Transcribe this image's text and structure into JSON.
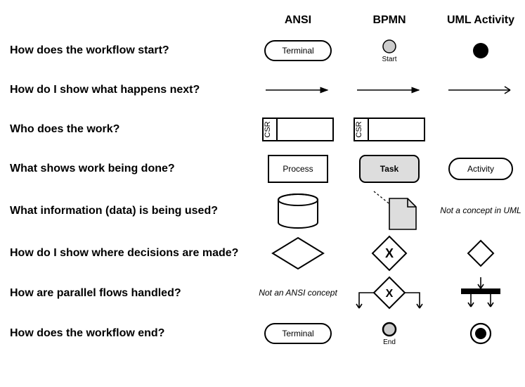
{
  "headers": {
    "ansi": "ANSI",
    "bpmn": "BPMN",
    "uml": "UML Activity"
  },
  "questions": {
    "q1": "How does the workflow start?",
    "q2": "How do I show what happens next?",
    "q3": "Who does the work?",
    "q4": "What shows work being done?",
    "q5": "What information (data) is being used?",
    "q6": "How do I show where decisions are made?",
    "q7": "How are parallel flows handled?",
    "q8": "How does the workflow end?"
  },
  "labels": {
    "terminal": "Terminal",
    "start": "Start",
    "end": "End",
    "csr": "CSR",
    "process": "Process",
    "task": "Task",
    "activity": "Activity",
    "not_uml": "Not a concept in UML",
    "not_ansi": "Not an ANSI concept"
  }
}
